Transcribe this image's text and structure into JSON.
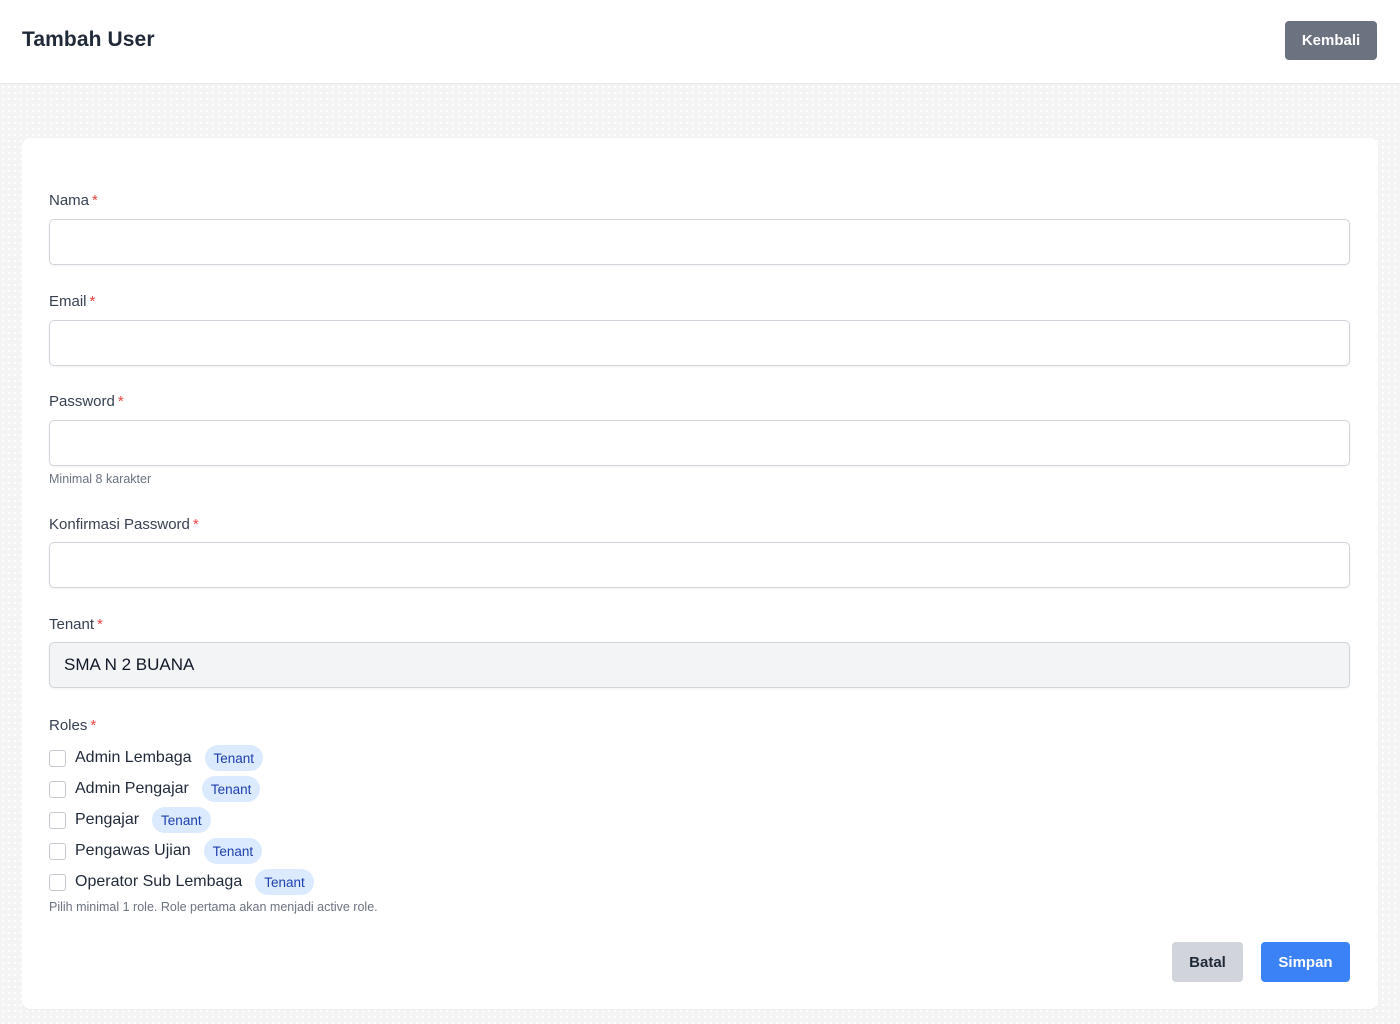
{
  "header": {
    "title": "Tambah User",
    "back_label": "Kembali"
  },
  "form": {
    "nama": {
      "label": "Nama",
      "required_mark": "*",
      "value": ""
    },
    "email": {
      "label": "Email",
      "required_mark": "*",
      "value": ""
    },
    "password": {
      "label": "Password",
      "required_mark": "*",
      "value": "",
      "hint": "Minimal 8 karakter"
    },
    "konfirmasi": {
      "label": "Konfirmasi Password",
      "required_mark": "*",
      "value": ""
    },
    "tenant": {
      "label": "Tenant",
      "required_mark": "*",
      "value": "SMA N 2 BUANA"
    },
    "roles": {
      "label": "Roles",
      "required_mark": "*",
      "items": [
        {
          "name": "Admin Lembaga",
          "badge": "Tenant",
          "checked": false
        },
        {
          "name": "Admin Pengajar",
          "badge": "Tenant",
          "checked": false
        },
        {
          "name": "Pengajar",
          "badge": "Tenant",
          "checked": false
        },
        {
          "name": "Pengawas Ujian",
          "badge": "Tenant",
          "checked": false
        },
        {
          "name": "Operator Sub Lembaga",
          "badge": "Tenant",
          "checked": false
        }
      ],
      "hint": "Pilih minimal 1 role. Role pertama akan menjadi active role."
    }
  },
  "actions": {
    "cancel_label": "Batal",
    "save_label": "Simpan"
  },
  "colors": {
    "primary": "#3b82f6",
    "secondary": "#6b7280",
    "required": "#ef4444",
    "badge_bg": "#dbeafe"
  }
}
